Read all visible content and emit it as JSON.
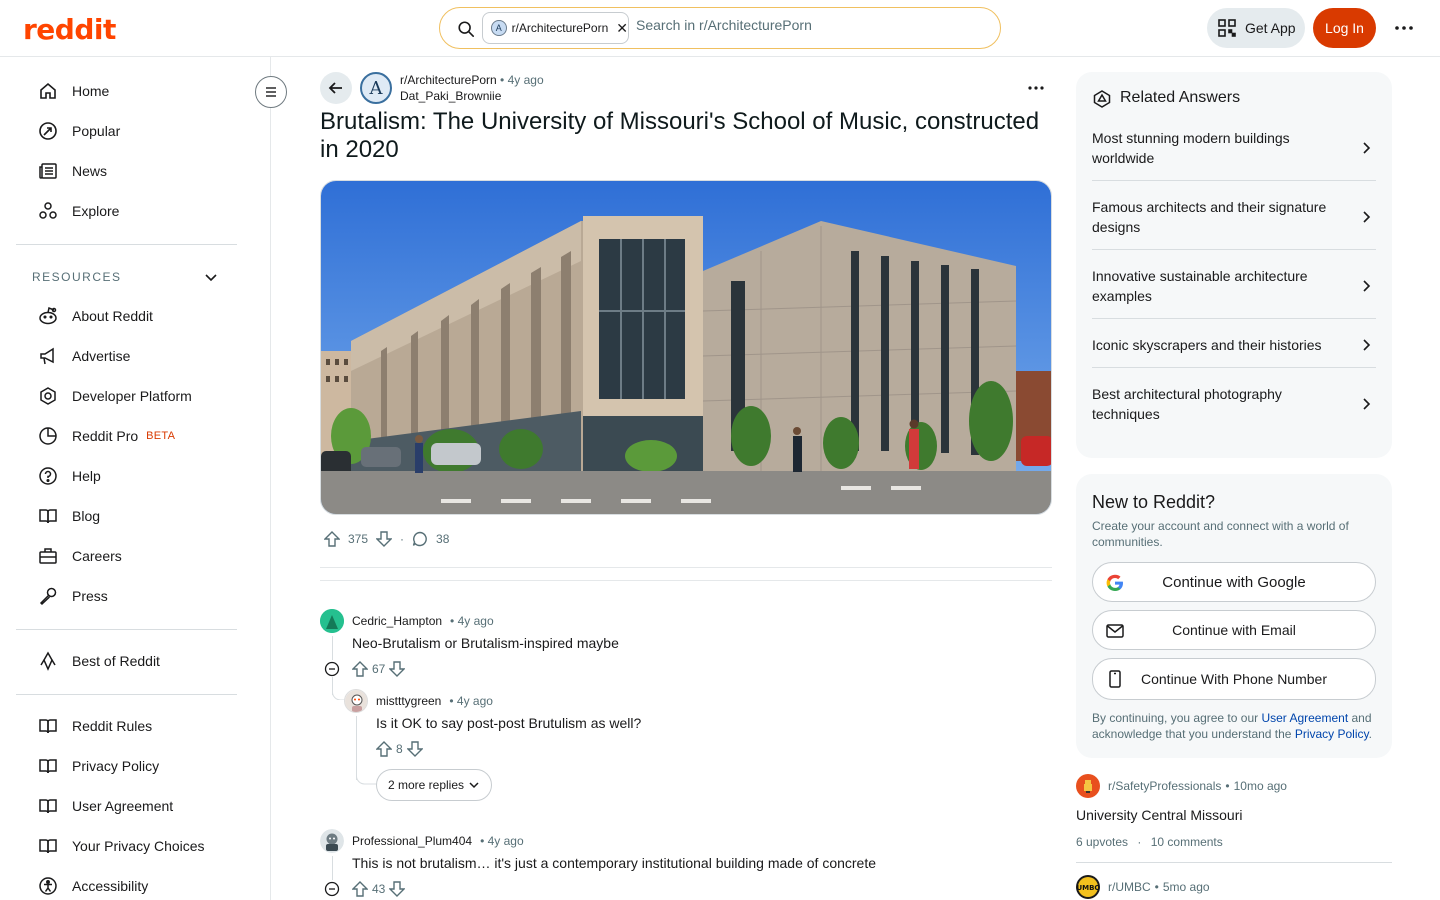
{
  "header": {
    "logo": "reddit",
    "search_chip": "r/ArchitecturePorn",
    "search_placeholder": "Search in r/ArchitecturePorn",
    "get_app": "Get App",
    "login": "Log In"
  },
  "sidebar": {
    "nav": [
      {
        "label": "Home",
        "icon": "home-icon"
      },
      {
        "label": "Popular",
        "icon": "popular-icon"
      },
      {
        "label": "News",
        "icon": "news-icon"
      },
      {
        "label": "Explore",
        "icon": "explore-icon"
      }
    ],
    "resources_label": "RESOURCES",
    "resources": [
      {
        "label": "About Reddit",
        "icon": "reddit-alien-icon"
      },
      {
        "label": "Advertise",
        "icon": "megaphone-icon"
      },
      {
        "label": "Developer Platform",
        "icon": "developer-icon"
      },
      {
        "label": "Reddit Pro",
        "icon": "pro-icon",
        "badge": "BETA"
      },
      {
        "label": "Help",
        "icon": "help-icon"
      },
      {
        "label": "Blog",
        "icon": "book-icon"
      },
      {
        "label": "Careers",
        "icon": "briefcase-icon"
      },
      {
        "label": "Press",
        "icon": "microphone-icon"
      }
    ],
    "best_of": {
      "label": "Best of Reddit",
      "icon": "best-of-icon"
    },
    "policies": [
      {
        "label": "Reddit Rules",
        "icon": "rules-icon"
      },
      {
        "label": "Privacy Policy",
        "icon": "policy-icon"
      },
      {
        "label": "User Agreement",
        "icon": "agreement-icon"
      },
      {
        "label": "Your Privacy Choices",
        "icon": "privacy-choices-icon"
      },
      {
        "label": "Accessibility",
        "icon": "accessibility-icon"
      }
    ]
  },
  "post": {
    "subreddit": "r/ArchitecturePorn",
    "age": "4y ago",
    "author": "Dat_Paki_Browniie",
    "title": "Brutalism: The University of Missouri's School of Music, constructed in 2020",
    "upvotes": "375",
    "comments": "38"
  },
  "comments": [
    {
      "author": "Cedric_Hampton",
      "age": "4y ago",
      "body": "Neo-Brutalism or Brutalism-inspired maybe",
      "votes": "67"
    },
    {
      "author": "mistttygreen",
      "age": "4y ago",
      "body": "Is it OK to say post-post Brutulism as well?",
      "votes": "8"
    },
    {
      "author": "Professional_Plum404",
      "age": "4y ago",
      "body": "This is not brutalism… it's just a contemporary institutional building made of concrete",
      "votes": "43"
    }
  ],
  "more_replies": "2 more replies",
  "related": {
    "title": "Related Answers",
    "items": [
      "Most stunning modern buildings worldwide",
      "Famous architects and their signature designs",
      "Innovative sustainable architecture examples",
      "Iconic skyscrapers and their histories",
      "Best architectural photography techniques"
    ]
  },
  "new_to_reddit": {
    "title": "New to Reddit?",
    "subtitle": "Create your account and connect with a world of communities.",
    "google": "Continue with Google",
    "email": "Continue with Email",
    "phone": "Continue With Phone Number",
    "legal_pre": "By continuing, you agree to our ",
    "legal_link1": "User Agreement",
    "legal_mid": " and acknowledge that you understand the ",
    "legal_link2": "Privacy Policy",
    "legal_end": "."
  },
  "feed": [
    {
      "subreddit": "r/SafetyProfessionals",
      "age": "10mo ago",
      "title": "University Central Missouri",
      "upvotes": "6 upvotes",
      "comments": "10 comments"
    },
    {
      "subreddit": "r/UMBC",
      "age": "5mo ago"
    }
  ],
  "colors": {
    "brand": "#ff4500",
    "login_bg": "#d93a00",
    "link": "#0045ac"
  }
}
